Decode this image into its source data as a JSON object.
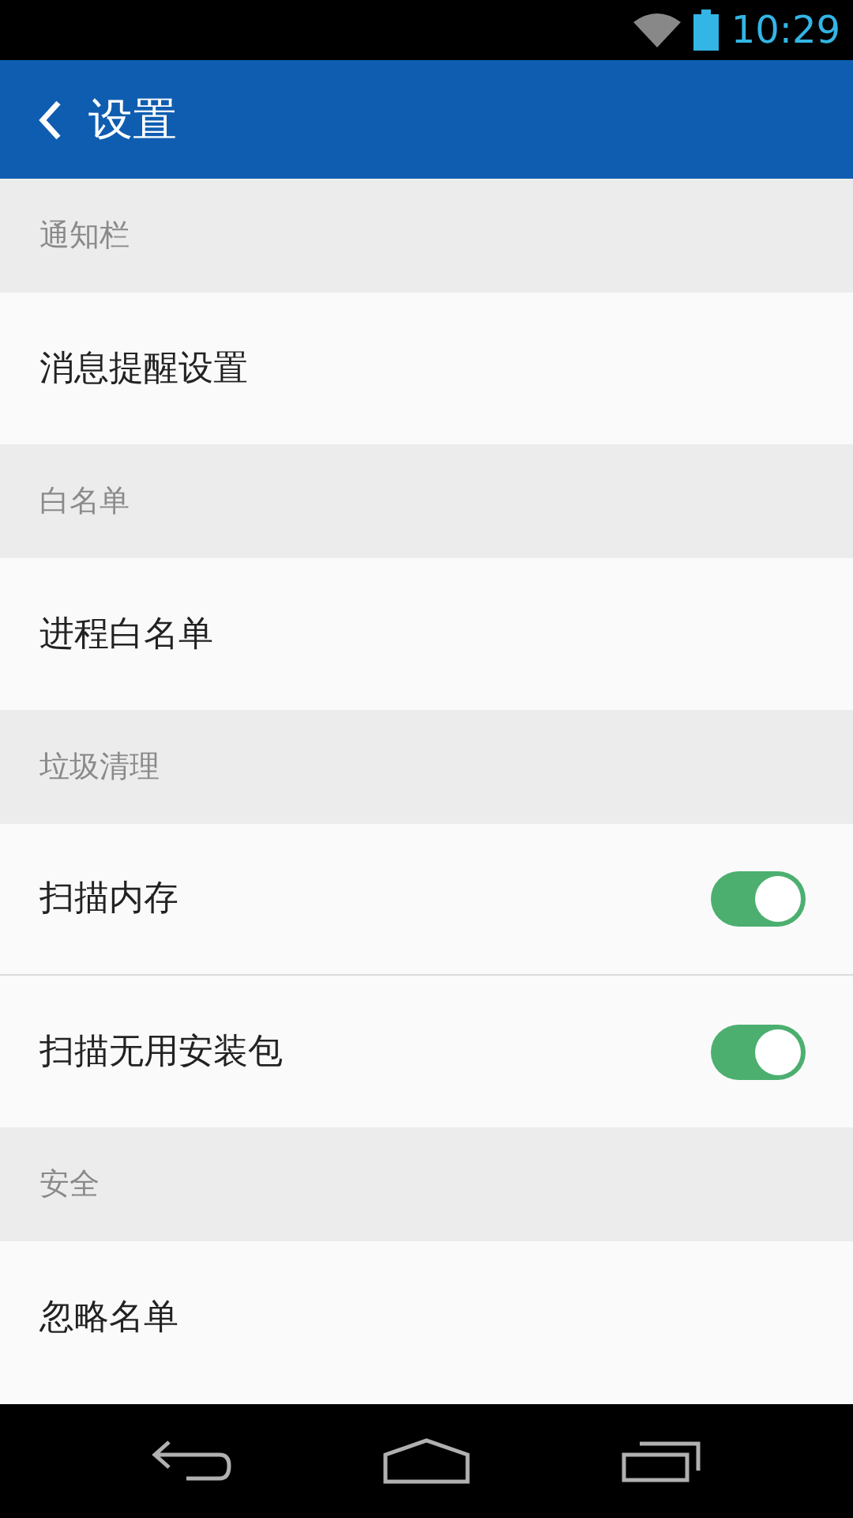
{
  "status_bar": {
    "time": "10:29"
  },
  "app_bar": {
    "title": "设置"
  },
  "sections": [
    {
      "header": "通知栏",
      "items": [
        {
          "label": "消息提醒设置",
          "kind": "link"
        }
      ]
    },
    {
      "header": "白名单",
      "items": [
        {
          "label": "进程白名单",
          "kind": "link"
        }
      ]
    },
    {
      "header": "垃圾清理",
      "items": [
        {
          "label": "扫描内存",
          "kind": "toggle",
          "on": true
        },
        {
          "label": "扫描无用安装包",
          "kind": "toggle",
          "on": true
        }
      ]
    },
    {
      "header": "安全",
      "items": [
        {
          "label": "忽略名单",
          "kind": "link"
        }
      ]
    }
  ]
}
